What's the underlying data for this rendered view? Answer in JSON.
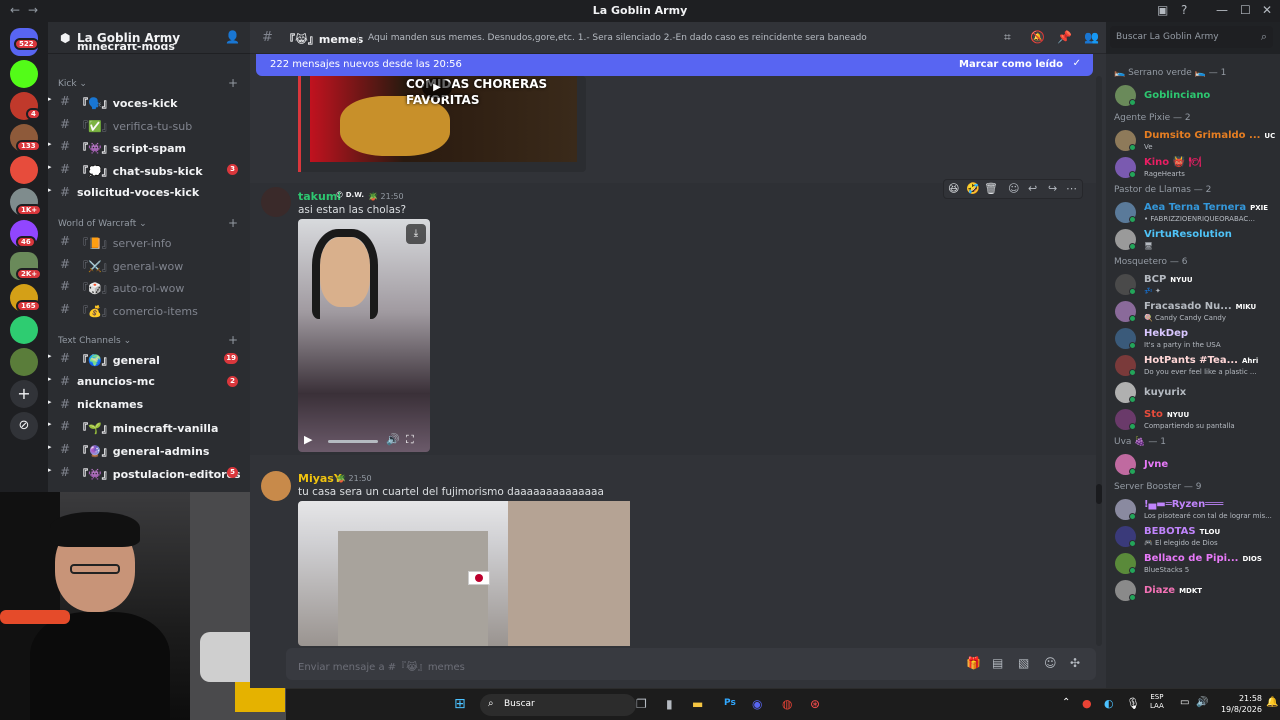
{
  "window": {
    "title": "La Goblin Army"
  },
  "servers": {
    "badges": [
      "522",
      "4",
      "133",
      "1K+",
      "46",
      "2K+",
      "165"
    ]
  },
  "sidebar": {
    "server_name": "La Goblin Army",
    "top_partial": "minecraft-mods",
    "categories": [
      {
        "label": "Kick"
      },
      {
        "label": "World of Warcraft"
      },
      {
        "label": "Text Channels"
      }
    ],
    "kick_channels": [
      {
        "prefix": "『🗣️』",
        "name": "voces-kick",
        "badge": ""
      },
      {
        "prefix": "『✅』",
        "name": "verifica-tu-sub",
        "badge": ""
      },
      {
        "prefix": "『👾』",
        "name": "script-spam",
        "badge": ""
      },
      {
        "prefix": "『💭』",
        "name": "chat-subs-kick",
        "badge": "3"
      },
      {
        "prefix": "",
        "name": "solicitud-voces-kick",
        "badge": ""
      }
    ],
    "wow_channels": [
      {
        "prefix": "『📙』",
        "name": "server-info"
      },
      {
        "prefix": "『⚔️』",
        "name": "general-wow"
      },
      {
        "prefix": "『🎲』",
        "name": "auto-rol-wow"
      },
      {
        "prefix": "『💰』",
        "name": "comercio-items"
      }
    ],
    "text_channels": [
      {
        "prefix": "『🌍』",
        "name": "general",
        "badge": "19"
      },
      {
        "prefix": "",
        "name": "anuncios-mc",
        "badge": "2"
      },
      {
        "prefix": "",
        "name": "nicknames",
        "badge": ""
      },
      {
        "prefix": "『🌱』",
        "name": "minecraft-vanilla",
        "badge": ""
      },
      {
        "prefix": "『🔮』",
        "name": "general-admins",
        "badge": ""
      },
      {
        "prefix": "『👾』",
        "name": "postulacion-editores",
        "badge": "5"
      }
    ]
  },
  "header": {
    "channel": "『😹』memes",
    "topic": "Aqui manden sus memes. Desnudos,gore,etc. 1.- Sera silenciado 2.-En dado caso es reincidente sera baneado",
    "search_placeholder": "Buscar La Goblin Army"
  },
  "banner": {
    "text": "222 mensajes nuevos desde las 20:56",
    "action": "Marcar como leído"
  },
  "messages": [
    {
      "user": "takumi",
      "tag": "D.W.",
      "time": "21:50",
      "text": "asi estan las cholas?",
      "name_color": "#2dc770"
    },
    {
      "user": "MiyasY",
      "tag": "",
      "time": "21:50",
      "text": "tu casa sera un cuartel del fujimorismo daaaaaaaaaaaaaa",
      "name_color": "#f1c40f"
    }
  ],
  "embed_top": {
    "caption": "COMIDAS CHORERAS FAVORITAS"
  },
  "compose": {
    "placeholder": "Enviar mensaje a #『😹』memes"
  },
  "members": {
    "groups": [
      {
        "label": "🛌 Serrano verde 🛌 — 1",
        "items": [
          {
            "name": "Goblinciano",
            "status": "",
            "color": "#2dc770",
            "tag": ""
          }
        ]
      },
      {
        "label": "Agente Pixie — 2",
        "items": [
          {
            "name": "Dumsito Grimaldo ...",
            "status": "Ve",
            "color": "#e67e22",
            "tag": "UC"
          },
          {
            "name": "Kino 👹 🍽",
            "status": "RageHearts",
            "color": "#e91e63",
            "tag": ""
          }
        ]
      },
      {
        "label": "Pastor de Llamas — 2",
        "items": [
          {
            "name": "Aea Terna Ternera",
            "status": "• FABRIZZIOENRIQUEORABAC...",
            "color": "#3498db",
            "tag": "PXIE"
          },
          {
            "name": "VirtuResolution",
            "status": "🖥",
            "color": "#4fc3f7",
            "tag": ""
          }
        ]
      },
      {
        "label": "Mosquetero — 6",
        "items": [
          {
            "name": "BCP",
            "status": "💤 ✦",
            "color": "#b5bac1",
            "tag": "NYUU"
          },
          {
            "name": "Fracasado Nu...",
            "status": "🍭 Candy Candy Candy",
            "color": "#b5bac1",
            "tag": "MIKU"
          },
          {
            "name": "HekDep",
            "status": "It's a party in the USA",
            "color": "#d9c7ff",
            "tag": ""
          },
          {
            "name": "HotPants #Tea...",
            "status": "Do you ever feel like a plastic ...",
            "color": "#ffd7d7",
            "tag": "Ahri"
          },
          {
            "name": "kuyurix",
            "status": "",
            "color": "#b5bac1",
            "tag": ""
          },
          {
            "name": "Sto",
            "status": "Compartiendo su pantalla",
            "color": "#e74c3c",
            "tag": "NYUU"
          }
        ]
      },
      {
        "label": "Uva 🍇 — 1",
        "items": [
          {
            "name": "Jvne",
            "status": "",
            "color": "#e879f9",
            "tag": ""
          }
        ]
      },
      {
        "label": "Server Booster — 9",
        "items": [
          {
            "name": "!▄▬═Ryzen═══",
            "status": "Los pisotearé con tal de lograr mis...",
            "color": "#c084fc",
            "tag": ""
          },
          {
            "name": "BEBOTAS",
            "status": "🎮 El elegido de Dios",
            "color": "#c084fc",
            "tag": "TLOU"
          },
          {
            "name": "Bellaco de Pipi...",
            "status": "BlueStacks 5",
            "color": "#e879f9",
            "tag": "DIOS"
          },
          {
            "name": "Diaze",
            "status": "",
            "color": "#f472b6",
            "tag": "MDKT"
          }
        ]
      }
    ]
  },
  "taskbar": {
    "search_label": "Buscar",
    "lang_line1": "ESP",
    "lang_line2": "LAA",
    "time": "21:58",
    "date": "19/8/2026"
  },
  "colors": {
    "accent": "#5865f2",
    "badge": "#da373c",
    "online": "#23a55a"
  }
}
